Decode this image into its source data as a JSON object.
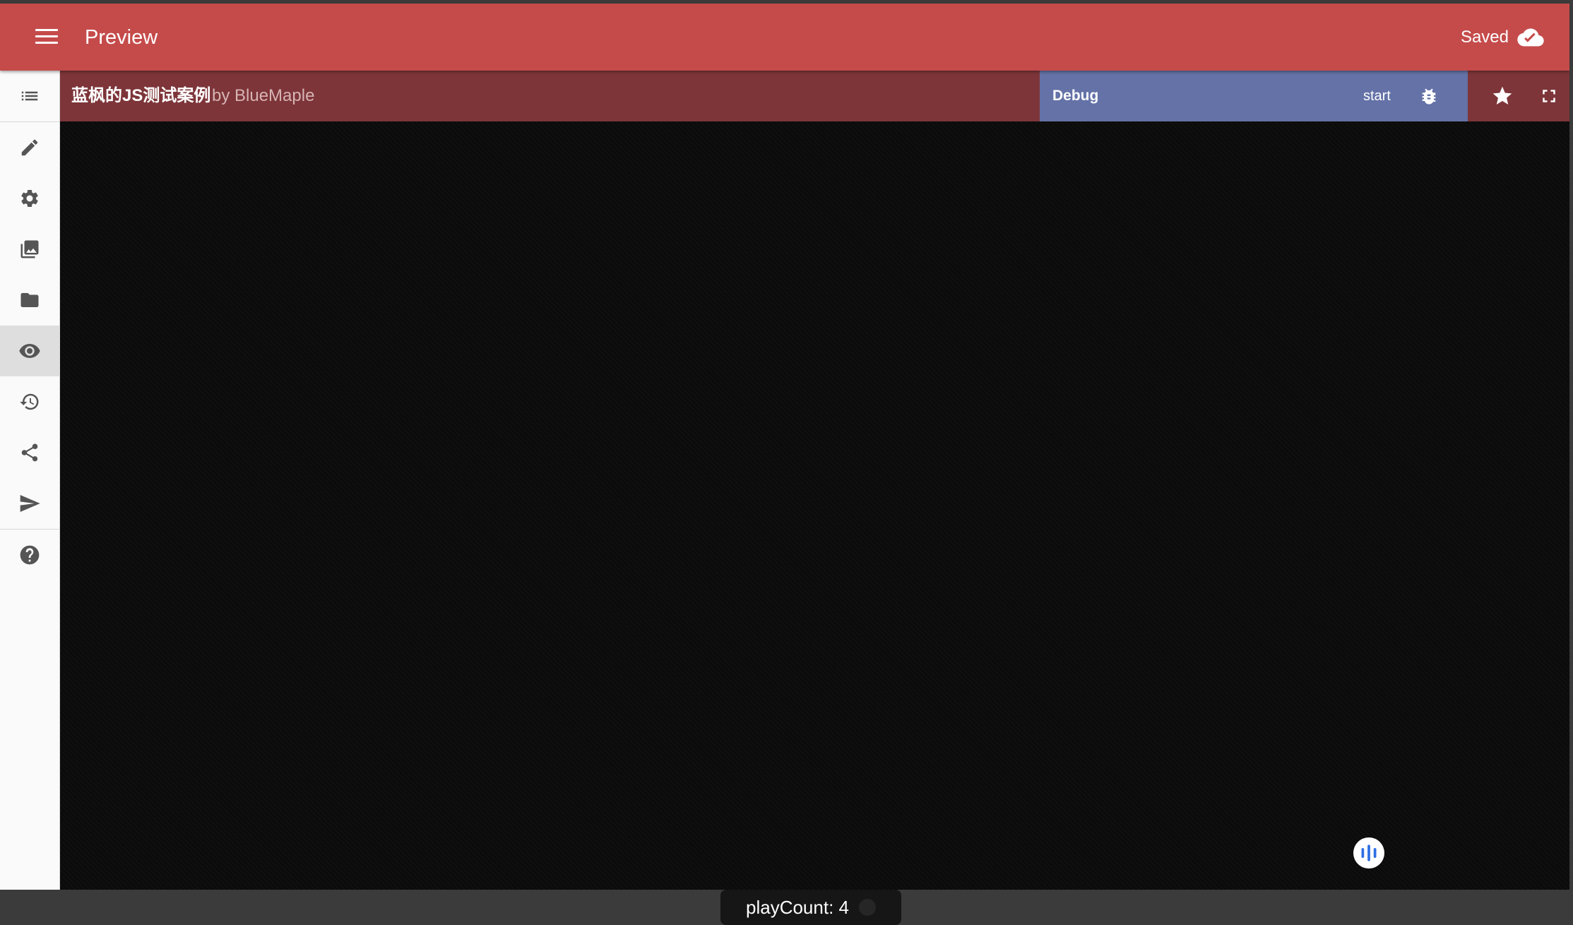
{
  "appbar": {
    "title": "Preview",
    "saved_label": "Saved"
  },
  "sidebar": {
    "items": [
      {
        "name": "list",
        "icon": "list-icon"
      },
      {
        "name": "edit",
        "icon": "pencil-icon"
      },
      {
        "name": "settings",
        "icon": "gear-icon"
      },
      {
        "name": "assets",
        "icon": "image-library-icon"
      },
      {
        "name": "files",
        "icon": "folder-icon"
      },
      {
        "name": "preview",
        "icon": "eye-icon",
        "active": true
      },
      {
        "name": "history",
        "icon": "history-icon"
      },
      {
        "name": "share",
        "icon": "share-icon"
      },
      {
        "name": "send",
        "icon": "send-icon"
      },
      {
        "name": "help",
        "icon": "help-icon"
      }
    ]
  },
  "project": {
    "title": "蓝枫的JS测试案例",
    "author": "by BlueMaple"
  },
  "debug": {
    "label": "Debug",
    "start_label": "start"
  },
  "player": {
    "play_count": "playCount: 4"
  },
  "colors": {
    "appbar": "#c54b4b",
    "title_bar": "#7d3539",
    "debug_panel": "#6472a7",
    "canvas": "#0b0b0b",
    "audio_icon": "#2f6fe4"
  }
}
